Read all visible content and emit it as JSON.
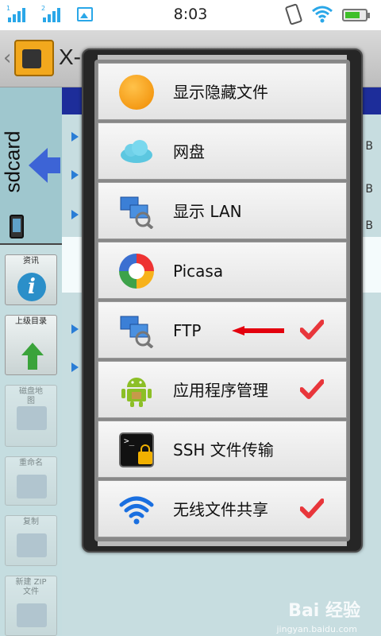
{
  "statusbar": {
    "time": "8:03",
    "signal_labels": [
      "1",
      "2"
    ]
  },
  "app": {
    "title": "X-"
  },
  "sidebar": {
    "storage_label": "sdcard",
    "buttons": [
      {
        "label": "资讯",
        "icon": "info-icon"
      },
      {
        "label": "上级目录",
        "icon": "up-arrow-icon"
      },
      {
        "label": "磁盘地图",
        "icon": "disk-map-icon"
      },
      {
        "label": "重命名",
        "icon": "rename-icon"
      },
      {
        "label": "复制",
        "icon": "copy-icon"
      },
      {
        "label": "新建 ZIP 文件",
        "icon": "zip-icon"
      }
    ]
  },
  "background_list": {
    "size_suffix": "B"
  },
  "menu": {
    "items": [
      {
        "label": "显示隐藏文件",
        "icon": "orange-circle-icon",
        "checked": false
      },
      {
        "label": "网盘",
        "icon": "cloud-icon",
        "checked": false
      },
      {
        "label": "显示 LAN",
        "icon": "lan-icon",
        "checked": false
      },
      {
        "label": "Picasa",
        "icon": "picasa-icon",
        "checked": false
      },
      {
        "label": "FTP",
        "icon": "ftp-icon",
        "checked": true
      },
      {
        "label": "应用程序管理",
        "icon": "android-icon",
        "checked": true
      },
      {
        "label": "SSH 文件传输",
        "icon": "terminal-lock-icon",
        "checked": false
      },
      {
        "label": "无线文件共享",
        "icon": "wifi-icon",
        "checked": true
      }
    ]
  },
  "watermark": {
    "text": "Bai 经验",
    "sub": "jingyan.baidu.com"
  },
  "colors": {
    "check_red": "#e8363b",
    "pointer_red": "#e3000e",
    "menu_bg": "#262626",
    "header_blue": "#1d2d9a"
  }
}
